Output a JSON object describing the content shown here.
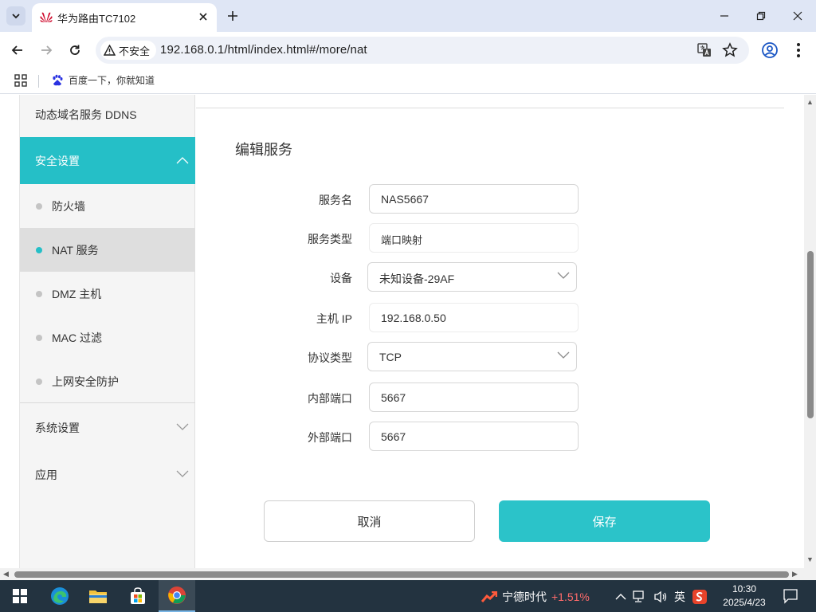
{
  "browser": {
    "tab_title": "华为路由TC7102",
    "security_label": "不安全",
    "url": "192.168.0.1/html/index.html#/more/nat",
    "bookmarks": [
      {
        "label": "百度一下，你就知道"
      }
    ]
  },
  "sidebar": {
    "top_item": "动态域名服务 DDNS",
    "security_section": "安全设置",
    "sub_items": [
      "防火墙",
      "NAT 服务",
      "DMZ 主机",
      "MAC 过滤",
      "上网安全防护"
    ],
    "active_sub_item": "NAT 服务",
    "system_section": "系统设置",
    "apps_section": "应用"
  },
  "form": {
    "title": "编辑服务",
    "fields": [
      {
        "label": "服务名",
        "value": "NAS5667",
        "type": "input"
      },
      {
        "label": "服务类型",
        "value": "端口映射",
        "type": "readonly"
      },
      {
        "label": "设备",
        "value": "未知设备-29AF",
        "type": "select"
      },
      {
        "label": "主机 IP",
        "value": "192.168.0.50",
        "type": "readonly"
      },
      {
        "label": "协议类型",
        "value": "TCP",
        "type": "select"
      },
      {
        "label": "内部端口",
        "value": "5667",
        "type": "input"
      },
      {
        "label": "外部端口",
        "value": "5667",
        "type": "input"
      }
    ],
    "cancel_label": "取消",
    "save_label": "保存"
  },
  "taskbar": {
    "stock_name": "宁德时代",
    "stock_change": "+1.51%",
    "ime": "英",
    "time": "10:30",
    "date": "2025/4/23"
  },
  "colors": {
    "accent": "#25bfc7",
    "save_button": "#2bc3c9",
    "stock_up": "#ff6b6b"
  }
}
